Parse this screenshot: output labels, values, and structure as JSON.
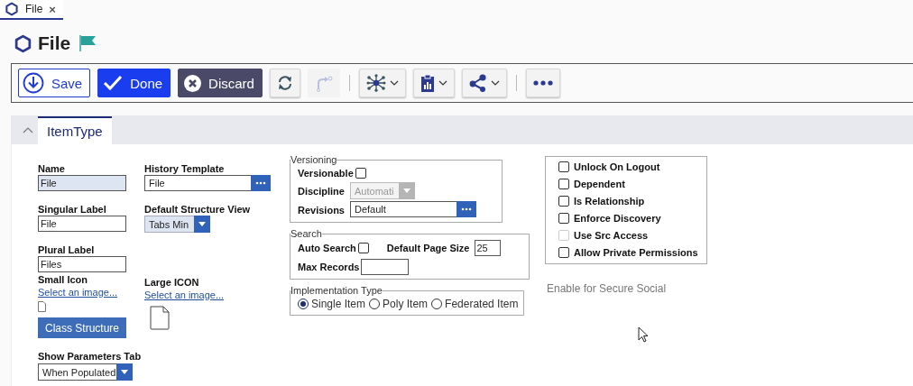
{
  "doc_tabs": [
    {
      "label": "File",
      "selected": true,
      "close": "×"
    }
  ],
  "title": "File",
  "toolbar": [
    {
      "kind": "save",
      "label": "Save"
    },
    {
      "kind": "done",
      "label": "Done"
    },
    {
      "kind": "discard",
      "label": "Discard"
    },
    {
      "kind": "refresh",
      "disabled": false
    },
    {
      "kind": "redo",
      "disabled": true
    },
    {
      "kind": "separator"
    },
    {
      "kind": "network",
      "disabled": false
    },
    {
      "kind": "report",
      "disabled": false
    },
    {
      "kind": "share",
      "disabled": false
    },
    {
      "kind": "separator"
    },
    {
      "kind": "more",
      "disabled": false
    }
  ],
  "panel": {
    "expanded": true,
    "tabs": [
      {
        "label": "ItemType",
        "selected": true
      }
    ]
  },
  "form": {
    "name": {
      "label": "Name",
      "value": "File",
      "readonly": true
    },
    "singular_label": {
      "label": "Singular Label",
      "value": "File"
    },
    "plural_label": {
      "label": "Plural Label",
      "value": "Files"
    },
    "small_icon": {
      "label": "Small Icon",
      "link": "Select an image..."
    },
    "class_structure_button": "Class Structure",
    "show_parameters_tab": {
      "label": "Show Parameters Tab",
      "value": "When Populated"
    },
    "history_template": {
      "label": "History Template",
      "value": "File"
    },
    "default_structure_view": {
      "label": "Default Structure View",
      "value": "Tabs Min"
    },
    "large_icon": {
      "label": "Large ICON",
      "link": "Select an image..."
    },
    "versioning": {
      "legend": "Versioning",
      "versionable": {
        "label": "Versionable",
        "checked": false
      },
      "discipline": {
        "label": "Discipline",
        "value": "Automati",
        "disabled": true
      },
      "revisions": {
        "label": "Revisions",
        "value": "Default"
      }
    },
    "search": {
      "legend": "Search",
      "auto_search": {
        "label": "Auto Search",
        "checked": false
      },
      "default_page_size": {
        "label": "Default Page Size",
        "value": "25"
      },
      "max_records": {
        "label": "Max Records"
      }
    },
    "implementation_type": {
      "legend": "Implementation Type",
      "options": [
        {
          "label": "Single Item",
          "selected": true
        },
        {
          "label": "Poly Item",
          "selected": false
        },
        {
          "label": "Federated Item",
          "selected": false
        }
      ]
    },
    "flags": [
      {
        "label": "Unlock On Logout",
        "checked": false,
        "disabled": false
      },
      {
        "label": "Dependent",
        "checked": false,
        "disabled": false
      },
      {
        "label": "Is Relationship",
        "checked": false,
        "disabled": false
      },
      {
        "label": "Enforce Discovery",
        "checked": false,
        "disabled": false
      },
      {
        "label": "Use Src Access",
        "checked": false,
        "disabled": true
      },
      {
        "label": "Allow Private Permissions",
        "checked": false,
        "disabled": false
      }
    ],
    "secure_social": "Enable for Secure Social"
  }
}
